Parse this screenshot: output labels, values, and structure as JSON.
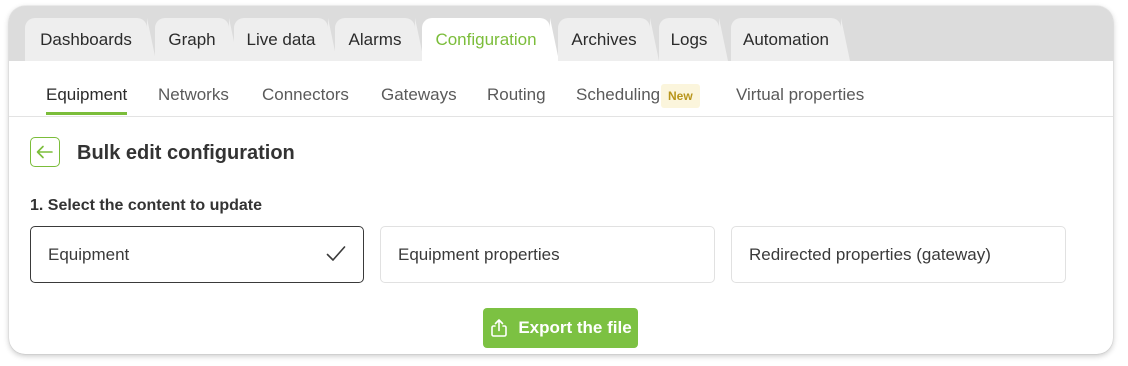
{
  "colors": {
    "accent": "#7bbd3a",
    "button_bg": "#7cc142",
    "tab_bar_bg": "#dcdcdc",
    "tab_bg": "#eeeeee",
    "badge_bg": "#fbf5dc",
    "badge_text": "#b8951c"
  },
  "main_tabs": [
    {
      "label": "Dashboards"
    },
    {
      "label": "Graph"
    },
    {
      "label": "Live data"
    },
    {
      "label": "Alarms"
    },
    {
      "label": "Configuration",
      "active": true
    },
    {
      "label": "Archives"
    },
    {
      "label": "Logs"
    },
    {
      "label": "Automation"
    }
  ],
  "sub_tabs": [
    {
      "label": "Equipment",
      "active": true
    },
    {
      "label": "Networks"
    },
    {
      "label": "Connectors"
    },
    {
      "label": "Gateways"
    },
    {
      "label": "Routing"
    },
    {
      "label": "Scheduling",
      "badge": "New"
    },
    {
      "label": "Virtual properties"
    }
  ],
  "page": {
    "back_icon": "arrow-left-icon",
    "title": "Bulk edit configuration",
    "step_label": "1. Select the content to update"
  },
  "options": [
    {
      "label": "Equipment",
      "selected": true,
      "icon": "checkmark-icon"
    },
    {
      "label": "Equipment properties",
      "selected": false
    },
    {
      "label": "Redirected properties (gateway)",
      "selected": false
    }
  ],
  "export_button": {
    "label": "Export the file",
    "icon": "upload-icon"
  }
}
